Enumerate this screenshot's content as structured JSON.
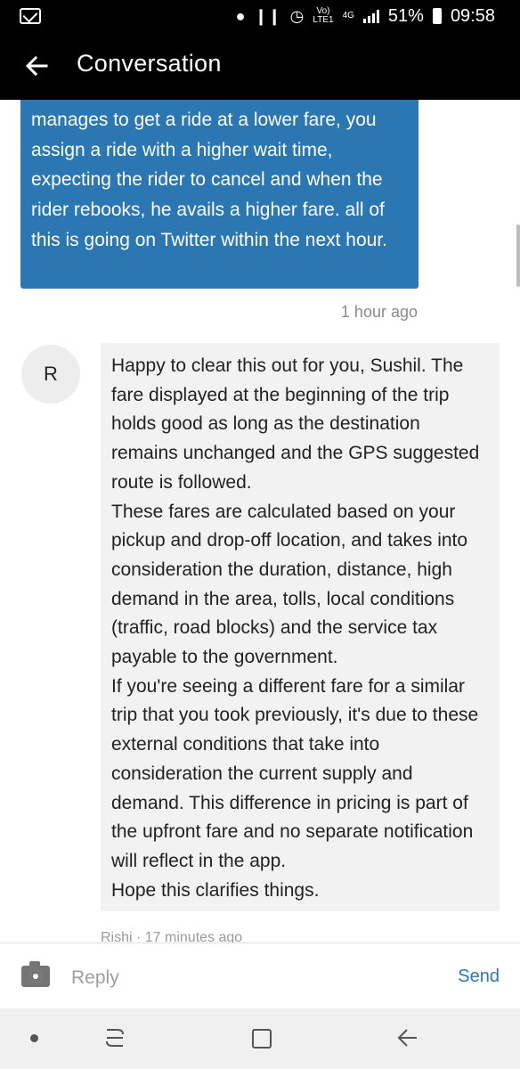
{
  "status_bar": {
    "volte": "Vo)",
    "lte": "LTE1",
    "network": "4G",
    "battery": "51%",
    "time": "09:58",
    "icons": [
      "mail-icon",
      "location-icon",
      "vibrate-icon",
      "alarm-icon",
      "signal-icon",
      "battery-icon"
    ]
  },
  "app_bar": {
    "title": "Conversation",
    "back_icon": "back-arrow-icon"
  },
  "messages": {
    "outgoing": {
      "text": "manages to get a ride at a lower fare, you assign a ride with a higher wait time, expecting the rider to cancel and when the rider rebooks, he avails a higher fare. all of this is going on Twitter within the next hour.",
      "time": "1 hour ago"
    },
    "incoming": {
      "avatar_letter": "R",
      "paragraphs": [
        "Happy to clear this out for you, Sushil. The fare displayed at the beginning of the trip holds good as long as the destination remains unchanged and the GPS suggested route is followed.",
        "These fares are calculated based on your pickup and drop-off location, and takes into consideration the duration, distance, high demand in the area, tolls, local conditions (traffic, road blocks) and the service tax payable to the government.",
        "If you're seeing a different fare for a similar trip that you took previously, it's due to these external conditions that take into consideration the current supply and demand. This difference in pricing is part of the upfront fare and no separate notification will reflect in the app.",
        "Hope this clarifies things."
      ],
      "meta": "Rishi · 17 minutes ago"
    }
  },
  "reply_bar": {
    "placeholder": "Reply",
    "send_label": "Send",
    "camera_icon": "camera-icon"
  },
  "nav_bar": {
    "icons": [
      "dot-icon",
      "recent-apps-icon",
      "home-icon",
      "back-icon"
    ]
  },
  "colors": {
    "accent": "#2b77b3",
    "outgoing_bubble": "#2b77b3",
    "incoming_bubble": "#f2f2f2",
    "header": "#000000"
  }
}
